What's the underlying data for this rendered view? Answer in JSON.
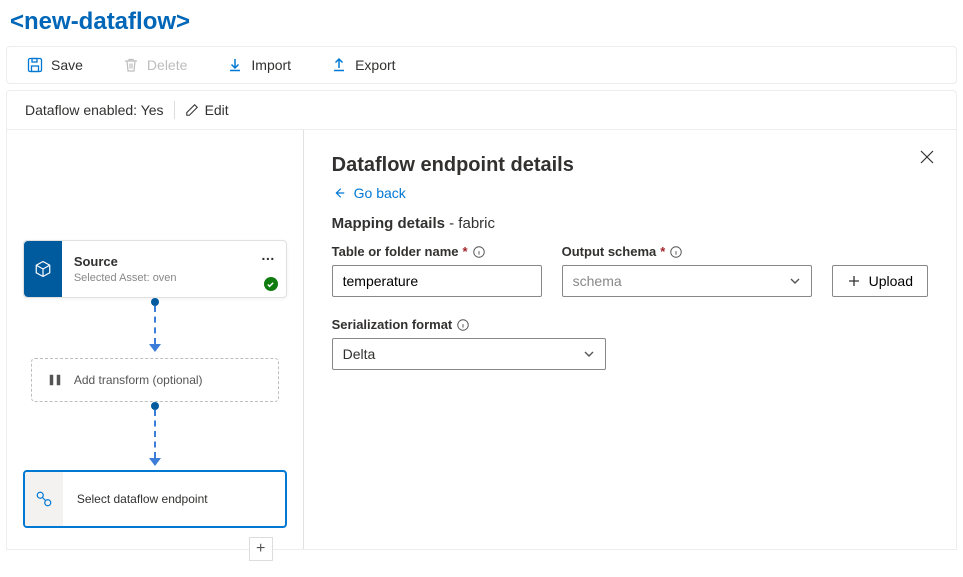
{
  "title": "<new-dataflow>",
  "toolbar": {
    "save": "Save",
    "delete": "Delete",
    "import": "Import",
    "export": "Export"
  },
  "status": {
    "enabled_label": "Dataflow enabled:",
    "enabled_value": "Yes",
    "edit": "Edit"
  },
  "nodes": {
    "source": {
      "title": "Source",
      "subtitle": "Selected Asset: oven"
    },
    "transform": {
      "label": "Add transform (optional)"
    },
    "endpoint": {
      "label": "Select dataflow endpoint"
    }
  },
  "detail": {
    "title": "Dataflow endpoint details",
    "go_back": "Go back",
    "section_prefix": "Mapping details",
    "section_suffix": "- fabric",
    "fields": {
      "table_label": "Table or folder name",
      "table_value": "temperature",
      "schema_label": "Output schema",
      "schema_placeholder": "schema",
      "upload": "Upload",
      "format_label": "Serialization format",
      "format_value": "Delta"
    }
  },
  "colors": {
    "brand": "#0078d4",
    "title": "#0066b8",
    "accent": "#005a9e",
    "success": "#107c10"
  }
}
